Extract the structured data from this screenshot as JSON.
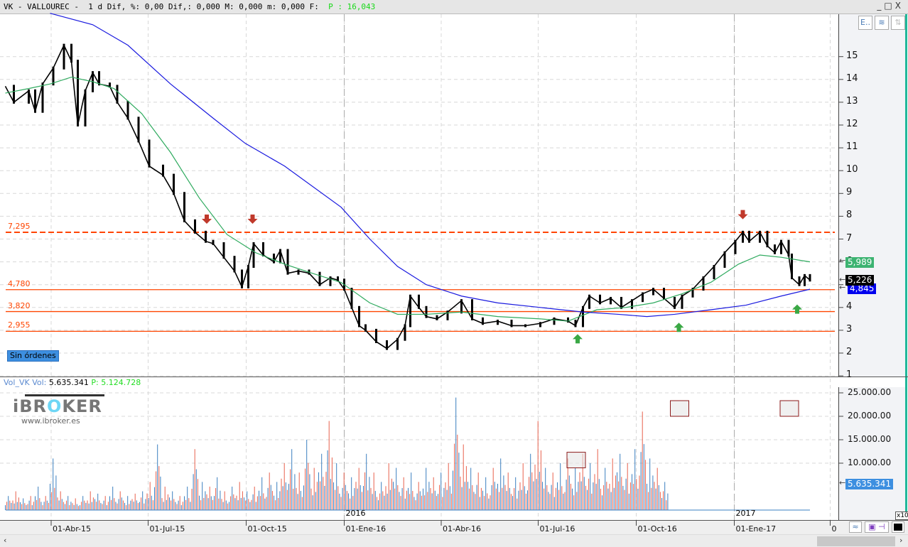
{
  "header": {
    "symbol": "VK - VALLOUREC -",
    "period": "1 d",
    "dif_pct_label": "Dif, %:",
    "dif_pct": "0,00",
    "dif_label": "Dif,:",
    "dif": "0,000",
    "max_label": "M:",
    "max": "0,000",
    "min_label": "m:",
    "min": "0,000",
    "f_label": "F:",
    "p_label": "P : 16,043"
  },
  "window_buttons": [
    "_",
    "□",
    "X"
  ],
  "toolbar_icons": [
    "axis-scale-icon",
    "database-icon",
    "sort-arrows-icon"
  ],
  "orders_badge": "Sin órdenes",
  "volume_header": {
    "name": "Vol_VK",
    "vol_label": "Vol:",
    "vol": "5.635.341",
    "p_label": "P:",
    "p": "5.124.728"
  },
  "logo": {
    "brand": "iBROKER",
    "url": "www.ibroker.es"
  },
  "price_badges": {
    "sma_short": "5,989",
    "last": "5,226",
    "sma_long": "4,845"
  },
  "volume_badge": "5.635.341",
  "volume_scale_note": "x10",
  "colors": {
    "price": "#000000",
    "sma_short": "#2eaa5e",
    "sma_long": "#1a1adf",
    "level": "#ff4500",
    "vol_up": "#3a7fc0",
    "vol_down": "#e8604c",
    "arrow_down": "#c0392b",
    "arrow_up": "#3aa845"
  },
  "chart_data": [
    {
      "type": "line",
      "title": "VK - VALLOUREC - 1 d",
      "x_unit": "days since 01-Abr-15",
      "ylim": [
        1,
        16.5
      ],
      "y_ticks": [
        "1",
        "2",
        "3",
        "4",
        "5",
        "6",
        "7",
        "8",
        "9",
        "10",
        "11",
        "12",
        "13",
        "14",
        "15"
      ],
      "x_ticks": [
        {
          "label": "01-Abr-15",
          "t": 0
        },
        {
          "label": "01-Jul-15",
          "t": 91
        },
        {
          "label": "01-Oct-15",
          "t": 183
        },
        {
          "label": "01-Ene-16",
          "t": 275
        },
        {
          "label": "01-Abr-16",
          "t": 366
        },
        {
          "label": "01-Jul-16",
          "t": 457
        },
        {
          "label": "01-Oct-16",
          "t": 549
        },
        {
          "label": "01-Ene-17",
          "t": 641
        },
        {
          "label": "0",
          "t": 731
        }
      ],
      "year_markers": [
        {
          "label": "2016",
          "t": 275
        },
        {
          "label": "2017",
          "t": 641
        }
      ],
      "levels": [
        {
          "label": "7,295",
          "value": 7.295,
          "style": "dashed"
        },
        {
          "label": "4,780",
          "value": 4.78,
          "style": "solid"
        },
        {
          "label": "3,820",
          "value": 3.82,
          "style": "solid"
        },
        {
          "label": "2,955",
          "value": 2.955,
          "style": "solid"
        }
      ],
      "series": [
        {
          "name": "VK price",
          "t": [
            -43,
            -35,
            -21,
            -15,
            -8,
            2,
            12,
            19,
            25,
            32,
            39,
            45,
            55,
            62,
            72,
            82,
            92,
            105,
            115,
            125,
            135,
            145,
            152,
            162,
            172,
            179,
            185,
            190,
            199,
            209,
            215,
            222,
            232,
            242,
            252,
            262,
            269,
            275,
            282,
            289,
            295,
            305,
            315,
            325,
            332,
            337,
            345,
            352,
            362,
            372,
            385,
            395,
            405,
            419,
            432,
            445,
            459,
            472,
            485,
            492,
            499,
            505,
            515,
            525,
            535,
            545,
            555,
            565,
            575,
            585,
            592,
            602,
            612,
            622,
            632,
            642,
            649,
            655,
            665,
            672,
            679,
            685,
            692,
            695,
            702,
            707,
            712
          ],
          "values": [
            13.7,
            13.0,
            13.5,
            12.6,
            13.8,
            14.5,
            15.5,
            14.8,
            12.0,
            13.5,
            14.3,
            13.8,
            13.7,
            13.0,
            12.3,
            11.3,
            10.2,
            9.8,
            9.0,
            7.8,
            7.3,
            6.9,
            6.8,
            6.2,
            5.6,
            4.9,
            5.8,
            6.8,
            6.3,
            6.0,
            6.5,
            5.5,
            5.6,
            5.5,
            5.0,
            5.3,
            5.2,
            4.8,
            4.0,
            3.2,
            3.0,
            2.5,
            2.2,
            2.6,
            3.2,
            4.5,
            4.0,
            3.6,
            3.5,
            3.8,
            4.3,
            3.5,
            3.3,
            3.4,
            3.2,
            3.2,
            3.3,
            3.5,
            3.4,
            3.2,
            4.0,
            4.5,
            4.2,
            4.4,
            4.0,
            4.3,
            4.6,
            4.8,
            4.4,
            4.0,
            4.5,
            4.8,
            5.3,
            5.8,
            6.4,
            6.9,
            7.3,
            6.9,
            7.3,
            6.7,
            6.4,
            6.9,
            6.3,
            5.3,
            5.0,
            5.4,
            5.2
          ]
        },
        {
          "name": "SMA short",
          "t": [
            -43,
            -21,
            -1,
            19,
            39,
            59,
            85,
            112,
            139,
            165,
            192,
            219,
            245,
            272,
            299,
            325,
            352,
            385,
            419,
            459,
            485,
            512,
            539,
            565,
            592,
            619,
            645,
            665,
            685,
            712
          ],
          "values": [
            13.4,
            13.6,
            13.8,
            14.1,
            13.9,
            13.6,
            12.5,
            10.8,
            8.8,
            7.2,
            6.4,
            5.9,
            5.5,
            5.1,
            4.2,
            3.7,
            3.7,
            3.8,
            3.6,
            3.5,
            3.4,
            3.9,
            4.0,
            4.2,
            4.6,
            5.1,
            5.9,
            6.3,
            6.2,
            6.0
          ]
        },
        {
          "name": "SMA long",
          "t": [
            -1,
            39,
            72,
            112,
            152,
            182,
            219,
            272,
            299,
            325,
            352,
            385,
            419,
            459,
            499,
            532,
            559,
            585,
            619,
            652,
            685,
            712
          ],
          "values": [
            16.9,
            16.4,
            15.5,
            13.8,
            12.3,
            11.2,
            10.2,
            8.4,
            7.0,
            5.8,
            5.0,
            4.5,
            4.2,
            4.0,
            3.8,
            3.7,
            3.6,
            3.7,
            3.9,
            4.1,
            4.5,
            4.8
          ]
        }
      ],
      "annotations": [
        {
          "type": "arrow-down",
          "t": 146,
          "value": 7.7
        },
        {
          "type": "arrow-down",
          "t": 189,
          "value": 7.7
        },
        {
          "type": "arrow-down",
          "t": 649,
          "value": 7.9
        },
        {
          "type": "arrow-up",
          "t": 494,
          "value": 2.8
        },
        {
          "type": "arrow-up",
          "t": 589,
          "value": 3.3
        },
        {
          "type": "arrow-up",
          "t": 700,
          "value": 4.1
        }
      ]
    },
    {
      "type": "bar",
      "title": "Vol_VK",
      "ylim": [
        0,
        25000000
      ],
      "y_ticks": [
        "25.000.00",
        "20.000.00",
        "15.000.00",
        "10.000.00"
      ],
      "t_step": 7,
      "t_start": -43,
      "values_millions": [
        3,
        4,
        2.5,
        3,
        5,
        3,
        11,
        4,
        3,
        2.5,
        3,
        4,
        3.5,
        3,
        5,
        4,
        3,
        3.5,
        4,
        6,
        14,
        5,
        4,
        3,
        5,
        13,
        6,
        5,
        7,
        4,
        5,
        6,
        4,
        5,
        7,
        8,
        6,
        10,
        13,
        8,
        15,
        9,
        12,
        19,
        10,
        8,
        7,
        9,
        12,
        8,
        6,
        10,
        9,
        7,
        8,
        6,
        9,
        7,
        8,
        10,
        24,
        14,
        9,
        8,
        7,
        9,
        11,
        8,
        7,
        10,
        12,
        19,
        9,
        8,
        10,
        11,
        9,
        12,
        10,
        13,
        9,
        11,
        12,
        10,
        13,
        21,
        11,
        9,
        6
      ],
      "highlight_boxes_t": [
        492,
        589,
        692
      ]
    }
  ]
}
